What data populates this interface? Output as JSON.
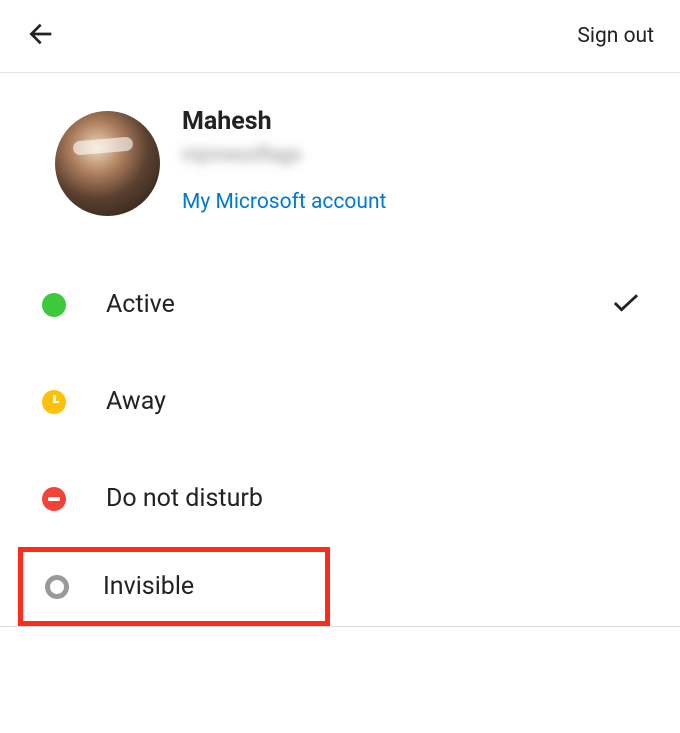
{
  "header": {
    "sign_out": "Sign out"
  },
  "profile": {
    "name": "Mahesh",
    "username_blurred": "mjnnessflags",
    "link": "My Microsoft account"
  },
  "status": {
    "items": [
      {
        "label": "Active",
        "selected": true
      },
      {
        "label": "Away",
        "selected": false
      },
      {
        "label": "Do not disturb",
        "selected": false
      },
      {
        "label": "Invisible",
        "selected": false
      }
    ]
  }
}
